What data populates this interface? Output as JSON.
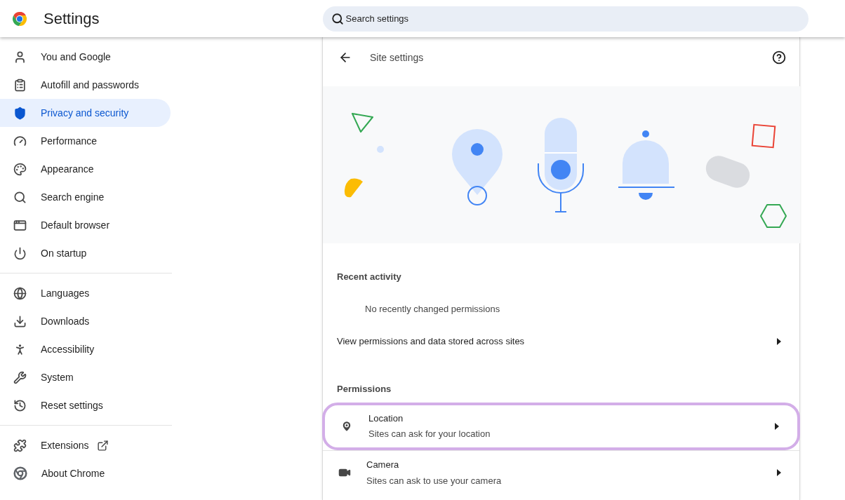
{
  "header": {
    "title": "Settings",
    "search": {
      "placeholder": "Search settings"
    }
  },
  "sidebar": {
    "sections": [
      {
        "items": [
          {
            "label": "You and Google",
            "selected": false,
            "kind": "page"
          },
          {
            "label": "Autofill and passwords",
            "selected": false,
            "kind": "page"
          },
          {
            "label": "Privacy and security",
            "selected": true,
            "kind": "page"
          },
          {
            "label": "Performance",
            "selected": false,
            "kind": "page"
          },
          {
            "label": "Appearance",
            "selected": false,
            "kind": "page"
          },
          {
            "label": "Search engine",
            "selected": false,
            "kind": "page"
          },
          {
            "label": "Default browser",
            "selected": false,
            "kind": "page"
          },
          {
            "label": "On startup",
            "selected": false,
            "kind": "page"
          }
        ]
      },
      {
        "items": [
          {
            "label": "Languages",
            "selected": false,
            "kind": "page"
          },
          {
            "label": "Downloads",
            "selected": false,
            "kind": "page"
          },
          {
            "label": "Accessibility",
            "selected": false,
            "kind": "page"
          },
          {
            "label": "System",
            "selected": false,
            "kind": "page"
          },
          {
            "label": "Reset settings",
            "selected": false,
            "kind": "page"
          }
        ]
      },
      {
        "items": [
          {
            "label": "Extensions",
            "selected": false,
            "kind": "external"
          },
          {
            "label": "About Chrome",
            "selected": false,
            "kind": "page"
          }
        ]
      }
    ]
  },
  "page": {
    "title": "Site settings",
    "recent_activity": {
      "heading": "Recent activity",
      "empty_text": "No recently changed permissions"
    },
    "view_all": {
      "label": "View permissions and data stored across sites"
    },
    "permissions": {
      "heading": "Permissions",
      "items": [
        {
          "title": "Location",
          "subtitle": "Sites can ask for your location",
          "highlighted": true
        },
        {
          "title": "Camera",
          "subtitle": "Sites can ask to use your camera",
          "highlighted": false
        }
      ]
    }
  }
}
